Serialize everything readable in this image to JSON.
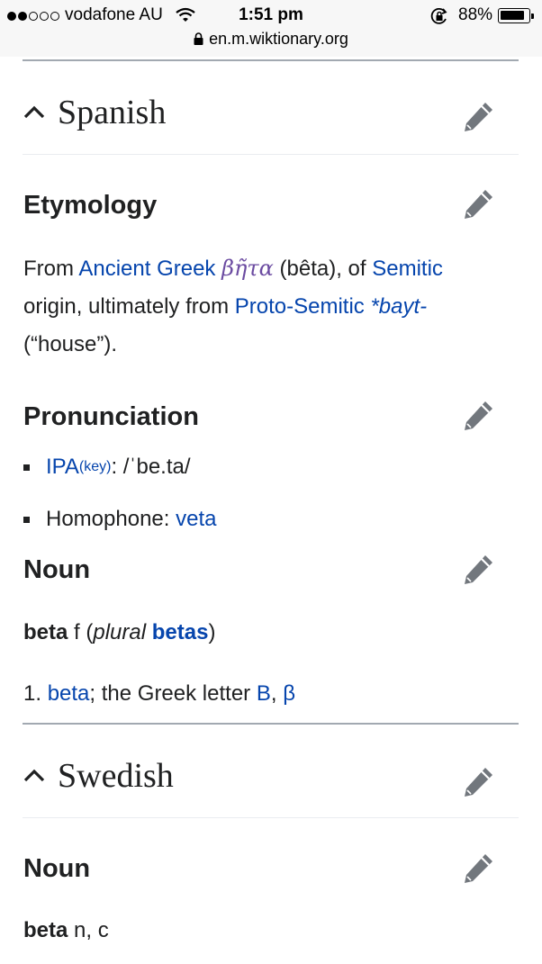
{
  "status": {
    "carrier": "vodafone AU",
    "time": "1:51 pm",
    "battery": "88%",
    "battery_level": 0.88,
    "url": "en.m.wiktionary.org"
  },
  "spanish": {
    "heading": "Spanish",
    "etym_heading": "Etymology",
    "etym": {
      "from": "From",
      "ancient_greek": "Ancient Greek",
      "greek_word": "βῆτα",
      "translit": "(bêta), of",
      "semitic": "Semitic",
      "origin": "origin, ultimately from",
      "proto": "Proto-Semitic",
      "bayt": "*bayt-",
      "house": "(“house”)."
    },
    "pron_heading": "Pronunciation",
    "ipa": "IPA",
    "key": "(key)",
    "ipa_value": ": /ˈbe.ta/",
    "homophone_label": "Homophone:",
    "homophone": "veta",
    "noun_heading": "Noun",
    "headword": "beta",
    "gender": "f",
    "plural_open": "(",
    "plural_label": "plural",
    "plural_form": "betas",
    "plural_close": ")",
    "def_num": "1.",
    "def_link": "beta",
    "def_text": "; the Greek letter",
    "def_b": "B",
    "def_comma": ",",
    "def_beta": "β"
  },
  "swedish": {
    "heading": "Swedish",
    "noun_heading": "Noun",
    "headword": "beta",
    "gender": "n, c"
  }
}
